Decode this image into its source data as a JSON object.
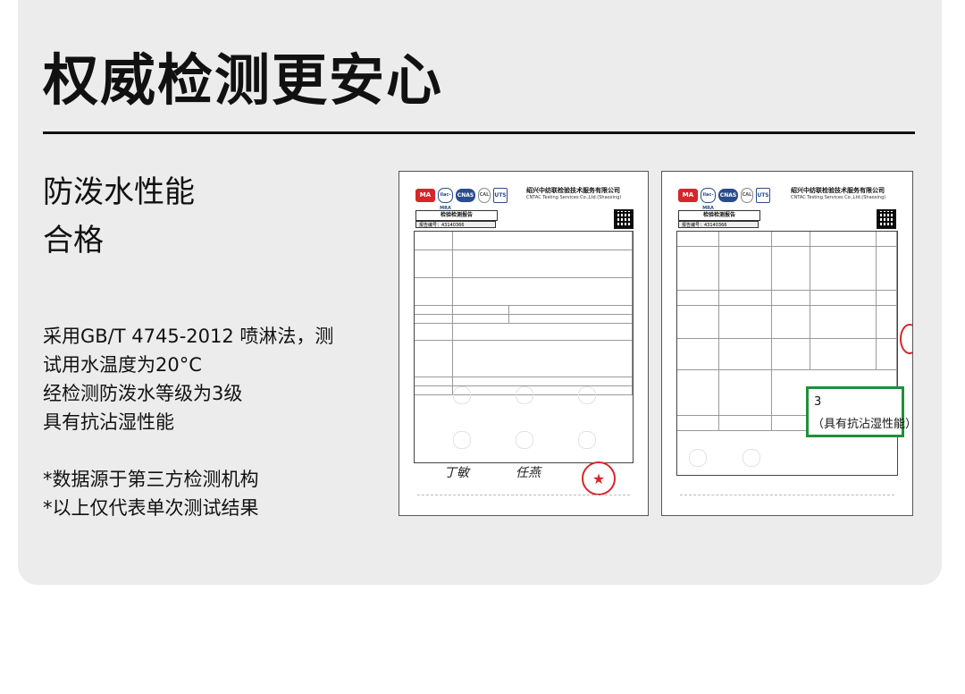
{
  "page": {
    "title": "权威检测更安心",
    "headline_lines": [
      "防泼水性能",
      "合格"
    ],
    "body_lines": [
      "采用GB/T 4745-2012 喷淋法，测",
      "试用水温度为20°C",
      "经检测防泼水等级为3级",
      "具有抗沾湿性能"
    ],
    "notes": [
      "*数据源于第三方检测机构",
      "*以上仅代表单次测试结果"
    ]
  },
  "reports": {
    "org_cn": "绍兴中纺联检验技术服务有限公司",
    "org_en": "CNTAC Testing Services Co.,Ltd.(Shaoxing)",
    "report_title": "检验检测报告",
    "report_no": "报告编号：43140366",
    "logos": {
      "ma": "MA",
      "ilac": "ilac-MRA",
      "cnas": "CNAS",
      "cal": "CAL",
      "uts": "UTS"
    },
    "left_signatures": [
      "丁敏",
      "任燕"
    ],
    "callout": {
      "grade": "3",
      "note": "（具有抗沾湿性能）"
    }
  },
  "colors": {
    "card_bg": "#ececec",
    "rule": "#111111",
    "callout_border": "#1f8f3a",
    "stamp": "#d6262b"
  }
}
